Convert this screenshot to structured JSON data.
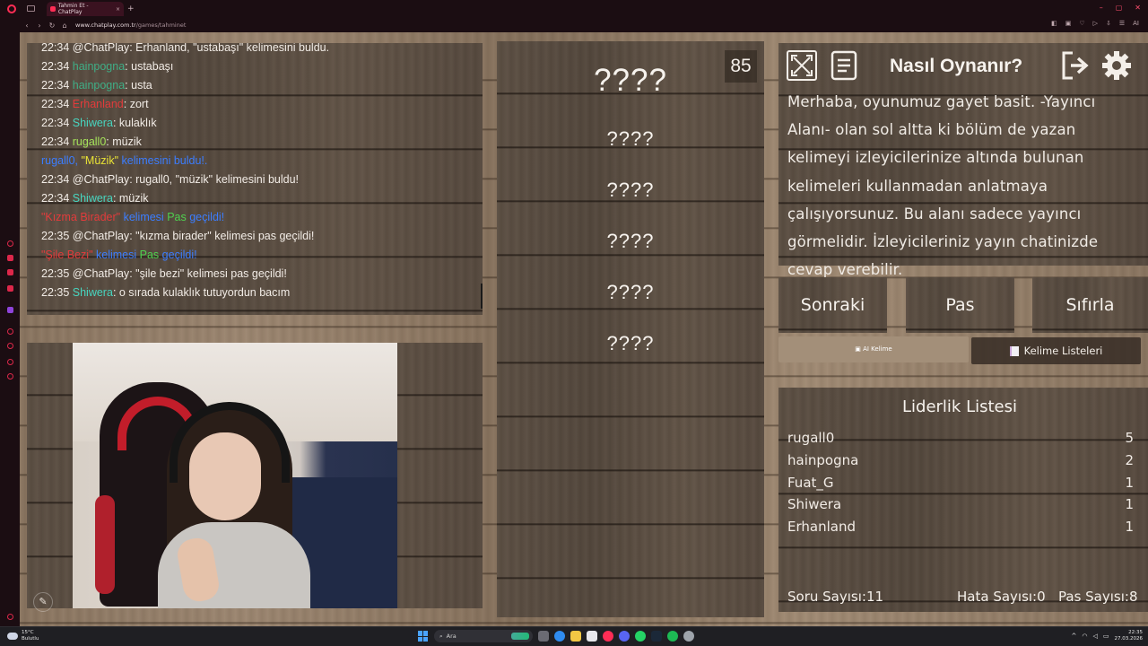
{
  "browser": {
    "tab_title": "Tahmin Et - ChatPlay",
    "tab_close": "×",
    "new_tab": "+",
    "url_domain": "www.chatplay.com.tr",
    "url_path": "/games/tahminet",
    "nav": {
      "back": "‹",
      "forward": "›",
      "reload": "↻",
      "home": "⌂"
    },
    "ai_label": "AI",
    "window_controls": {
      "minimize": "–",
      "maximize": "▢",
      "close": "✕"
    }
  },
  "chat": {
    "lines": [
      {
        "time": "22:34",
        "user": "@ChatPlay",
        "text": ": Erhanland, \"ustabaşı\" kelimesini buldu."
      },
      {
        "time": "22:34",
        "user": "hainpogna",
        "text": ": ustabaşı"
      },
      {
        "time": "22:34",
        "user": "hainpogna",
        "text": ": usta"
      },
      {
        "time": "22:34",
        "user": "Erhanland",
        "text": ": zort"
      },
      {
        "time": "22:34",
        "user": "Shiwera",
        "text": ": kulaklık"
      },
      {
        "time": "22:34",
        "user": "rugall0",
        "text": ": müzik"
      },
      {
        "sys_user": "rugall0,",
        "sys_word": "\"Müzik\"",
        "sys_rest": "kelimesini buldu!."
      },
      {
        "time": "22:34",
        "user": "@ChatPlay",
        "text": ": rugall0, \"müzik\" kelimesini buldu!"
      },
      {
        "time": "22:34",
        "user": "Shiwera",
        "text": ": müzik"
      },
      {
        "sys_word": "\"Kızma Birader\"",
        "sys_mid": "kelimesi",
        "sys_pas": "Pas",
        "sys_rest": "geçildi!"
      },
      {
        "time": "22:35",
        "user": "@ChatPlay",
        "text": ": \"kızma birader\" kelimesi pas geçildi!"
      },
      {
        "sys_word": "\"Şile Bezi\"",
        "sys_mid": "kelimesi",
        "sys_pas": "Pas",
        "sys_rest": "geçildi!"
      },
      {
        "time": "22:35",
        "user": "@ChatPlay",
        "text": ": \"şile bezi\" kelimesi pas geçildi!"
      },
      {
        "time": "22:35",
        "user": "Shiwera",
        "text": ": o sırada kulaklık tutuyordun bacım"
      }
    ]
  },
  "game": {
    "counter": "85",
    "words": [
      "????",
      "????",
      "????",
      "????",
      "????",
      "????"
    ]
  },
  "howto": {
    "title": "Nasıl Oynanır?",
    "text": "Merhaba, oyunumuz gayet basit. -Yayıncı Alanı- olan sol altta ki bölüm de yazan kelimeyi izleyicilerinize altında bulunan kelimeleri kullanmadan anlatmaya çalışıyorsunuz. Bu alanı sadece yayıncı görmelidir. İzleyicileriniz yayın chatinizde cevap verebilir."
  },
  "controls": {
    "next": "Sonraki",
    "pass": "Pas",
    "reset": "Sıfırla",
    "ai_word": "AI Kelime",
    "word_lists": "Kelime Listeleri"
  },
  "leaderboard": {
    "title": "Liderlik Listesi",
    "rows": [
      {
        "name": "rugall0",
        "score": "5"
      },
      {
        "name": "hainpogna",
        "score": "2"
      },
      {
        "name": "Fuat_G",
        "score": "1"
      },
      {
        "name": "Shiwera",
        "score": "1"
      },
      {
        "name": "Erhanland",
        "score": "1"
      }
    ]
  },
  "stats": {
    "questions_label": "Soru Sayısı:",
    "questions": "11",
    "errors_label": "Hata Sayısı:",
    "errors": "0",
    "passes_label": "Pas Sayısı:",
    "passes": "8"
  },
  "taskbar": {
    "weather_temp": "15°C",
    "weather_desc": "Bulutlu",
    "search_placeholder": "Ara",
    "time": "22:35",
    "date": "27.03.2026",
    "tray_arrow": "^"
  },
  "colors": {
    "brand": "#ff2d55",
    "wood_light": "#9c8670",
    "wood_dark": "#574a3f",
    "ai_button": "#a38f79"
  }
}
